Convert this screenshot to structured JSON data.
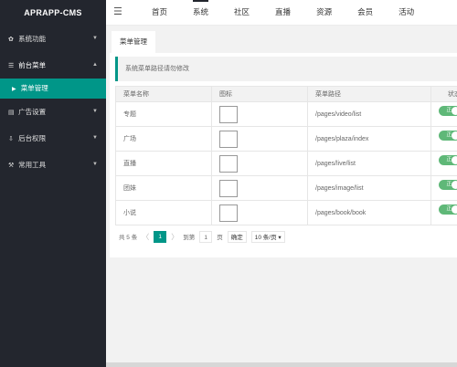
{
  "app": {
    "title": "APRAPP-CMS"
  },
  "sidebar": {
    "items": [
      {
        "label": "系统功能",
        "icon": "gear-icon",
        "glyph": "✿",
        "chevron": "▼"
      },
      {
        "label": "前台菜单",
        "icon": "list-icon",
        "glyph": "☰",
        "chevron": "▲",
        "subitems": [
          {
            "label": "菜单管理",
            "bullet": "▶"
          }
        ]
      },
      {
        "label": "广告设置",
        "icon": "document-icon",
        "glyph": "▤",
        "chevron": "▼"
      },
      {
        "label": "后台权限",
        "icon": "download-icon",
        "glyph": "⇩",
        "chevron": "▼"
      },
      {
        "label": "常用工具",
        "icon": "wrench-icon",
        "glyph": "⚒",
        "chevron": "▼"
      }
    ]
  },
  "topnav": {
    "menu_glyph": "☰",
    "items": [
      "首页",
      "系统",
      "社区",
      "直播",
      "资源",
      "会员",
      "活动"
    ],
    "active_index": 1
  },
  "tabs": [
    "菜单管理"
  ],
  "notice": "系统菜单路径请勿修改",
  "table": {
    "headers": [
      "菜单名称",
      "图标",
      "菜单路径",
      "状态"
    ],
    "rows": [
      {
        "name": "专题",
        "path": "/pages/video/list",
        "status": "正常"
      },
      {
        "name": "广场",
        "path": "/pages/plaza/index",
        "status": "正常"
      },
      {
        "name": "直播",
        "path": "/pages/live/list",
        "status": "正常"
      },
      {
        "name": "团妹",
        "path": "/pages/image/list",
        "status": "正常"
      },
      {
        "name": "小说",
        "path": "/pages/book/book",
        "status": "正常"
      }
    ]
  },
  "pager": {
    "total": "共 5 条",
    "prev": "〈",
    "current": "1",
    "next": "〉",
    "goto_label": "到第",
    "goto_value": "1",
    "page_unit": "页",
    "confirm": "确定",
    "per_page": "10 条/页 ▾"
  },
  "colors": {
    "accent": "#009688",
    "sidebar": "#23262e",
    "status": "#5fb878"
  }
}
